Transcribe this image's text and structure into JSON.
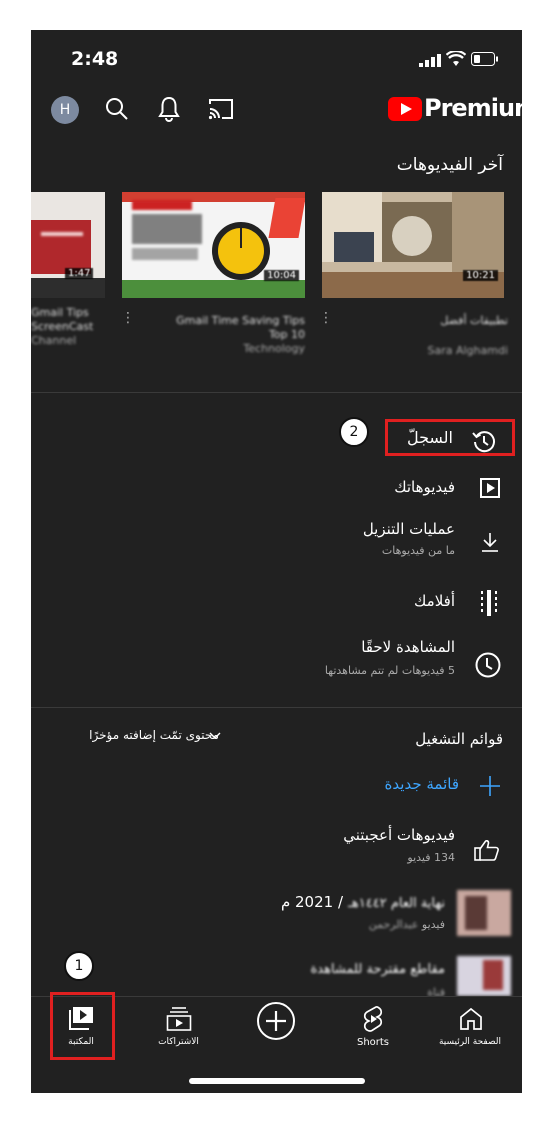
{
  "status_bar": {
    "time": "2:48"
  },
  "header": {
    "avatar_initial": "H",
    "brand": "Premium"
  },
  "recent": {
    "title": "آخر الفيديوهات",
    "videos": [
      {
        "duration": "1:47",
        "title_line1": "Gmail Tips",
        "title_line2": "ScreenCast",
        "channel": "Channel"
      },
      {
        "duration": "10:04",
        "title_line1": "Gmail Time Saving Tips",
        "title_line2": "Top 10",
        "channel": "Technology"
      },
      {
        "duration": "10:21",
        "title_line1": "تطبيقات أفضل",
        "title_line2": "",
        "channel": "Sara Alghamdi"
      }
    ]
  },
  "menu": {
    "history": "السجلّ",
    "your_videos": "فيديوهاتك",
    "downloads": {
      "title": "عمليات التنزيل",
      "subtitle": "ما من فيديوهات"
    },
    "movies": "أفلامك",
    "watch_later": {
      "title": "المشاهدة لاحقًا",
      "subtitle": "5 فيديوهات لم تتم مشاهدتها"
    }
  },
  "playlists": {
    "title": "قوائم التشغيل",
    "sort_label": "محتوى تمّت إضافته مؤخرًا",
    "new_playlist": "قائمة جديدة",
    "liked": {
      "title": "فيديوهات أعجبتني",
      "count": "134 فيديو"
    },
    "item1": {
      "title_prefix": "/ 2021 م",
      "title_blur": "نهاية العام ١٤٤٢هـ",
      "meta_suffix": "فيديو",
      "meta_blur": "عبدالرحمن"
    },
    "item2": {
      "title_blur": "مقاطع مقترحة للمشاهدة",
      "meta_blur": "قناة"
    }
  },
  "bottom_nav": {
    "home": "الصفحة الرئيسية",
    "shorts": "Shorts",
    "subscriptions": "الاشتراكات",
    "library": "المكتبة"
  },
  "annotations": {
    "marker1": "1",
    "marker2": "2"
  },
  "colors": {
    "background": "#212121",
    "brand_red": "#ff0000",
    "accent_blue": "#3ea6ff",
    "annotation_red": "#e02020"
  }
}
